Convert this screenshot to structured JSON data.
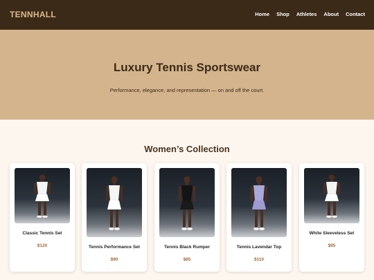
{
  "brand": {
    "logo": "TENNHALL"
  },
  "nav": {
    "links": [
      "Home",
      "Shop",
      "Athletes",
      "About",
      "Contact"
    ]
  },
  "hero": {
    "title": "Luxury Tennis Sportswear",
    "subtitle": "Performance, elegance, and representation — on and off the court."
  },
  "collection": {
    "title": "Women’s Collection",
    "products": [
      {
        "name": "Classic Tennis Set",
        "price": "$120",
        "outfit": "white",
        "icon": "athlete-photo"
      },
      {
        "name": "Tennis Performance Set",
        "price": "$90",
        "outfit": "white",
        "icon": "athlete-photo"
      },
      {
        "name": "Tennis Black Rumper",
        "price": "$85",
        "outfit": "black",
        "icon": "athlete-photo"
      },
      {
        "name": "Tennis Lavendar Top",
        "price": "$110",
        "outfit": "lavender",
        "icon": "athlete-photo"
      },
      {
        "name": "White Sleeveless Set",
        "price": "$95",
        "outfit": "white",
        "icon": "athlete-photo"
      }
    ]
  },
  "colors": {
    "nav_bg": "#3b2a18",
    "logo": "#d9b98a",
    "hero_bg": "#d4b48c",
    "page_bg": "#fdf6ef",
    "price": "#a0683a"
  }
}
